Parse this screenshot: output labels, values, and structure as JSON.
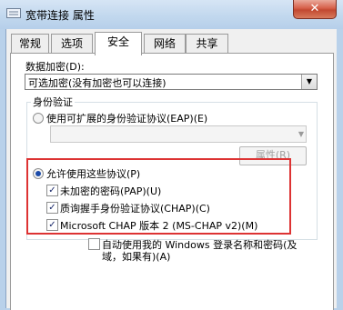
{
  "window": {
    "title": "宽带连接 属性",
    "close_label": "✕"
  },
  "tabs": [
    {
      "label": "常规"
    },
    {
      "label": "选项"
    },
    {
      "label": "安全"
    },
    {
      "label": "网络"
    },
    {
      "label": "共享"
    }
  ],
  "security": {
    "data_encryption_label": "数据加密(D):",
    "data_encryption_value": "可选加密(没有加密也可以连接)",
    "auth_group_title": "身份验证",
    "eap_option_label": "使用可扩展的身份验证协议(EAP)(E)",
    "eap_selected": false,
    "properties_button": "属性(R)",
    "allow_protocols_label": "允许使用这些协议(P)",
    "allow_protocols_selected": true,
    "protocols": [
      {
        "label": "未加密的密码(PAP)(U)",
        "checked": true
      },
      {
        "label": "质询握手身份验证协议(CHAP)(C)",
        "checked": true
      },
      {
        "label": "Microsoft CHAP 版本 2 (MS-CHAP v2)(M)",
        "checked": true
      }
    ],
    "auto_logon_label_line1": "自动使用我的 Windows 登录名称和密码(及",
    "auto_logon_label_line2": "域，如果有)(A)",
    "auto_logon_checked": false
  },
  "colors": {
    "highlight_border": "#dd3333",
    "titlebar": "#c2d8ee",
    "close_button": "#c24830"
  },
  "icons": {
    "app": "network-connection-icon",
    "close": "close-icon",
    "dropdown": "chevron-down-icon"
  }
}
